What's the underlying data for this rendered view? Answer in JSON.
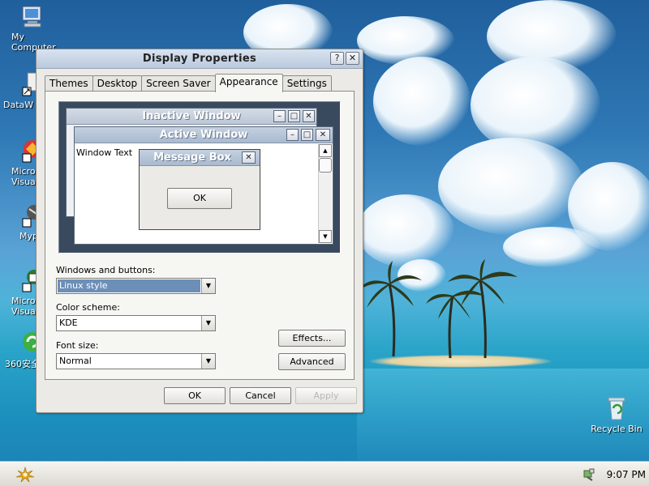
{
  "desktop": {
    "icons": [
      {
        "label": "My\nComputer",
        "icon": "my-computer-icon"
      },
      {
        "label": "DataW",
        "icon": "shortcut-icon"
      },
      {
        "label": "Micro\nVisual",
        "icon": "visual-studio-icon"
      },
      {
        "label": "Myp",
        "icon": "shortcut-icon"
      },
      {
        "label": "Micro\nVisual",
        "icon": "visual-studio-icon"
      },
      {
        "label": "360安全",
        "icon": "security-icon"
      }
    ],
    "recycle_bin": {
      "label": "Recycle Bin",
      "icon": "recycle-bin-icon"
    }
  },
  "dialog": {
    "title": "Display Properties",
    "help_glyph": "?",
    "close_glyph": "✕",
    "tabs": [
      "Themes",
      "Desktop",
      "Screen Saver",
      "Appearance",
      "Settings"
    ],
    "active_tab": "Appearance",
    "preview": {
      "inactive_title": "Inactive Window",
      "active_title": "Active Window",
      "window_text": "Window Text",
      "message_box_title": "Message Box",
      "message_box_button": "OK"
    },
    "windows_and_buttons": {
      "label": "Windows and buttons:",
      "value": "Linux style"
    },
    "color_scheme": {
      "label": "Color scheme:",
      "value": "KDE"
    },
    "font_size": {
      "label": "Font size:",
      "value": "Normal"
    },
    "effects_button": "Effects...",
    "advanced_button": "Advanced",
    "ok_button": "OK",
    "cancel_button": "Cancel",
    "apply_button": "Apply"
  },
  "taskbar": {
    "clock": "9:07 PM",
    "start_icon": "start-icon",
    "tray_icon": "network-icon"
  }
}
